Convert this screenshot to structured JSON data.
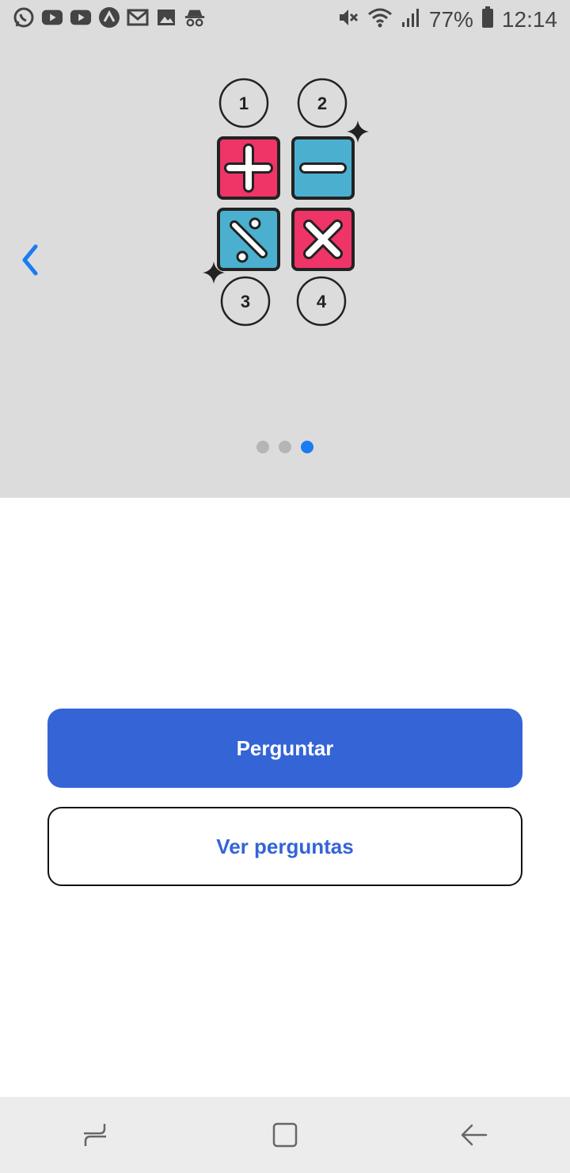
{
  "status_bar": {
    "notification_icons": [
      "whatsapp-icon",
      "youtube-icon",
      "youtube-icon",
      "app-icon",
      "gmail-icon",
      "gallery-icon",
      "incognito-icon"
    ],
    "status_icons": [
      "mute-icon",
      "wifi-icon",
      "signal-icon"
    ],
    "battery": "77%",
    "time": "12:14"
  },
  "carousel": {
    "image_labels": [
      "1",
      "2",
      "3",
      "4"
    ],
    "slide_count": 3,
    "active_slide": 3,
    "colors": {
      "pink": "#ef3467",
      "blue": "#4bb0cf",
      "dot_inactive": "#b5b5b5",
      "dot_active": "#1a7cf2"
    }
  },
  "actions": {
    "ask_label": "Perguntar",
    "view_label": "Ver perguntas"
  },
  "colors": {
    "accent": "#3464d6",
    "carousel_bg": "#dcdcdc"
  }
}
